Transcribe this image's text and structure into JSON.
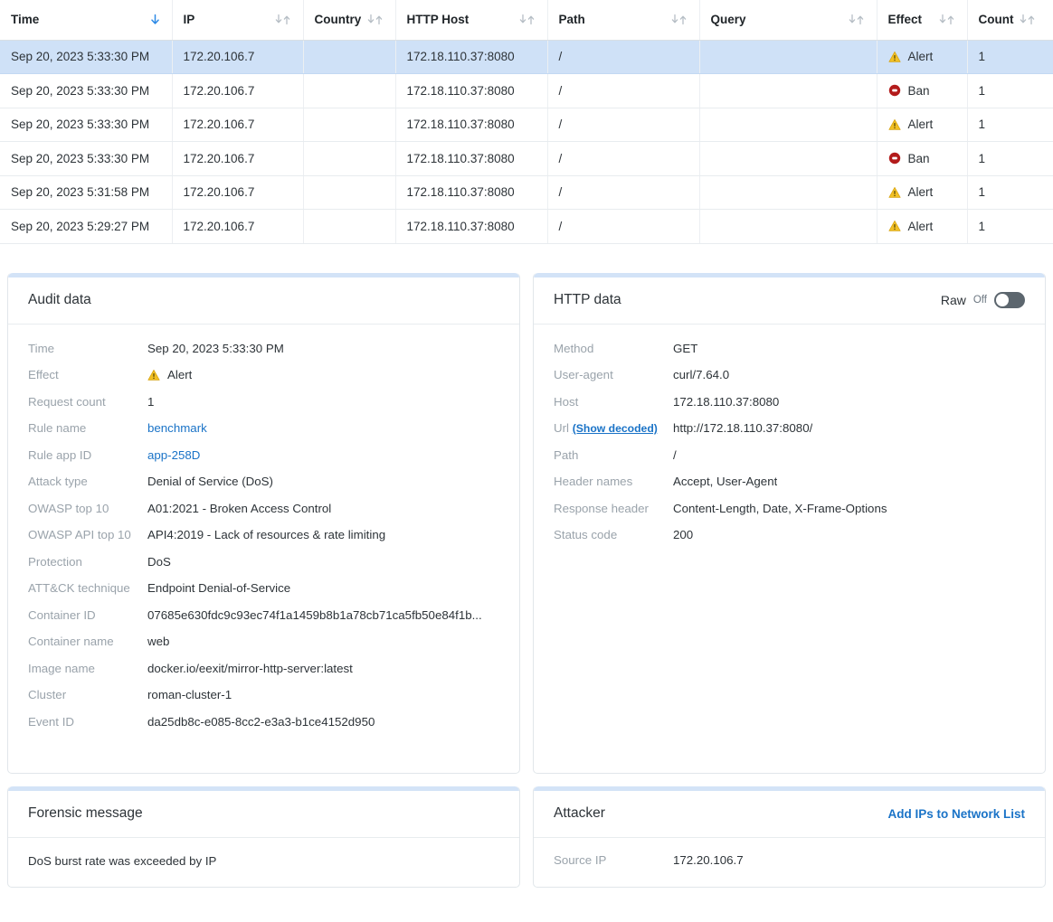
{
  "table": {
    "columns": [
      {
        "label": "Time",
        "sort": "desc"
      },
      {
        "label": "IP",
        "sort": "none"
      },
      {
        "label": "Country",
        "sort": "none"
      },
      {
        "label": "HTTP Host",
        "sort": "none"
      },
      {
        "label": "Path",
        "sort": "none"
      },
      {
        "label": "Query",
        "sort": "none"
      },
      {
        "label": "Effect",
        "sort": "none"
      },
      {
        "label": "Count",
        "sort": "none"
      }
    ],
    "rows": [
      {
        "time": "Sep 20, 2023 5:33:30 PM",
        "ip": "172.20.106.7",
        "country": "",
        "host": "172.18.110.37:8080",
        "path": "/",
        "query": "",
        "effect": "Alert",
        "effect_icon": "alert-triangle-icon",
        "count": "1",
        "selected": true
      },
      {
        "time": "Sep 20, 2023 5:33:30 PM",
        "ip": "172.20.106.7",
        "country": "",
        "host": "172.18.110.37:8080",
        "path": "/",
        "query": "",
        "effect": "Ban",
        "effect_icon": "ban-icon",
        "count": "1",
        "selected": false
      },
      {
        "time": "Sep 20, 2023 5:33:30 PM",
        "ip": "172.20.106.7",
        "country": "",
        "host": "172.18.110.37:8080",
        "path": "/",
        "query": "",
        "effect": "Alert",
        "effect_icon": "alert-triangle-icon",
        "count": "1",
        "selected": false
      },
      {
        "time": "Sep 20, 2023 5:33:30 PM",
        "ip": "172.20.106.7",
        "country": "",
        "host": "172.18.110.37:8080",
        "path": "/",
        "query": "",
        "effect": "Ban",
        "effect_icon": "ban-icon",
        "count": "1",
        "selected": false
      },
      {
        "time": "Sep 20, 2023 5:31:58 PM",
        "ip": "172.20.106.7",
        "country": "",
        "host": "172.18.110.37:8080",
        "path": "/",
        "query": "",
        "effect": "Alert",
        "effect_icon": "alert-triangle-icon",
        "count": "1",
        "selected": false
      },
      {
        "time": "Sep 20, 2023 5:29:27 PM",
        "ip": "172.20.106.7",
        "country": "",
        "host": "172.18.110.37:8080",
        "path": "/",
        "query": "",
        "effect": "Alert",
        "effect_icon": "alert-triangle-icon",
        "count": "1",
        "selected": false
      }
    ]
  },
  "audit_data": {
    "title": "Audit data",
    "fields": {
      "time_label": "Time",
      "time_value": "Sep 20, 2023 5:33:30 PM",
      "effect_label": "Effect",
      "effect_value": "Alert",
      "request_count_label": "Request count",
      "request_count_value": "1",
      "rule_name_label": "Rule name",
      "rule_name_value": "benchmark",
      "rule_app_id_label": "Rule app ID",
      "rule_app_id_value": "app-258D",
      "attack_type_label": "Attack type",
      "attack_type_value": "Denial of Service (DoS)",
      "owasp_top10_label": "OWASP top 10",
      "owasp_top10_value": "A01:2021 - Broken Access Control",
      "owasp_api_top10_label": "OWASP API top 10",
      "owasp_api_top10_value": "API4:2019 - Lack of resources & rate limiting",
      "protection_label": "Protection",
      "protection_value": "DoS",
      "attack_technique_label": "ATT&CK technique",
      "attack_technique_value": "Endpoint Denial-of-Service",
      "container_id_label": "Container ID",
      "container_id_value": "07685e630fdc9c93ec74f1a1459b8b1a78cb71ca5fb50e84f1b...",
      "container_name_label": "Container name",
      "container_name_value": "web",
      "image_name_label": "Image name",
      "image_name_value": "docker.io/eexit/mirror-http-server:latest",
      "cluster_label": "Cluster",
      "cluster_value": "roman-cluster-1",
      "event_id_label": "Event ID",
      "event_id_value": "da25db8c-e085-8cc2-e3a3-b1ce4152d950"
    }
  },
  "http_data": {
    "title": "HTTP data",
    "raw_label": "Raw",
    "raw_state": "Off",
    "fields": {
      "method_label": "Method",
      "method_value": "GET",
      "user_agent_label": "User-agent",
      "user_agent_value": "curl/7.64.0",
      "host_label": "Host",
      "host_value": "172.18.110.37:8080",
      "url_label": "Url",
      "url_show_decoded": "(Show decoded)",
      "url_value": "http://172.18.110.37:8080/",
      "path_label": "Path",
      "path_value": "/",
      "header_names_label": "Header names",
      "header_names_value": "Accept, User-Agent",
      "response_header_label": "Response header",
      "response_header_value": "Content-Length, Date, X-Frame-Options",
      "status_code_label": "Status code",
      "status_code_value": "200"
    }
  },
  "forensic": {
    "title": "Forensic message",
    "message": "DoS burst rate was exceeded by IP"
  },
  "attacker": {
    "title": "Attacker",
    "action_label": "Add IPs to Network List",
    "source_ip_label": "Source IP",
    "source_ip_value": "172.20.106.7"
  },
  "colors": {
    "link": "#1a73c7",
    "alert": "#f2c024",
    "ban": "#b31b1b",
    "selected_row": "#cfe1f7",
    "card_accent": "#d3e3f7"
  }
}
